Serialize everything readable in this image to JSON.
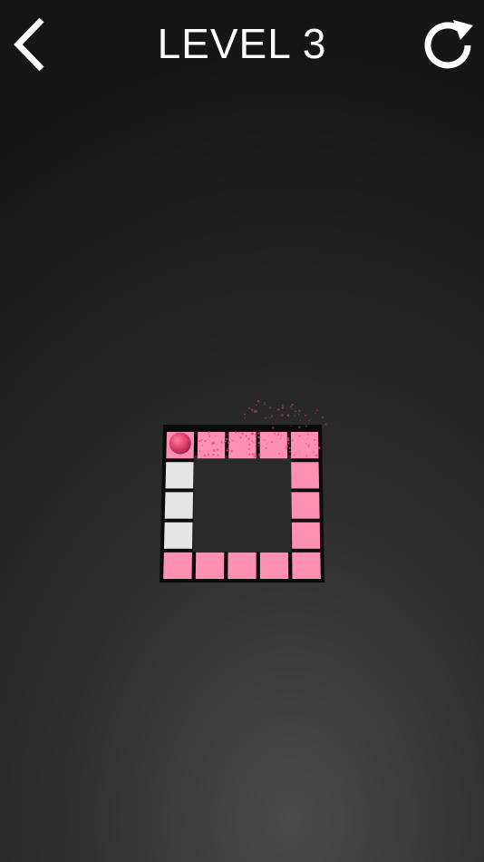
{
  "header": {
    "title": "LEVEL 3",
    "back_icon": "chevron-left-icon",
    "restart_icon": "restart-icon"
  },
  "colors": {
    "painted": "#ff8fb3",
    "unpainted": "#e6e6e6",
    "ball": "#e0406e",
    "wall": "#0b0b0b",
    "text": "#ffffff"
  },
  "game": {
    "grid_cols": 5,
    "grid_rows": 5,
    "tiles": [
      [
        1,
        1,
        1,
        1,
        1
      ],
      [
        0,
        -1,
        -1,
        -1,
        1
      ],
      [
        0,
        -1,
        -1,
        -1,
        1
      ],
      [
        0,
        -1,
        -1,
        -1,
        1
      ],
      [
        1,
        1,
        1,
        1,
        1
      ]
    ],
    "ball_cell": [
      0,
      0
    ]
  }
}
